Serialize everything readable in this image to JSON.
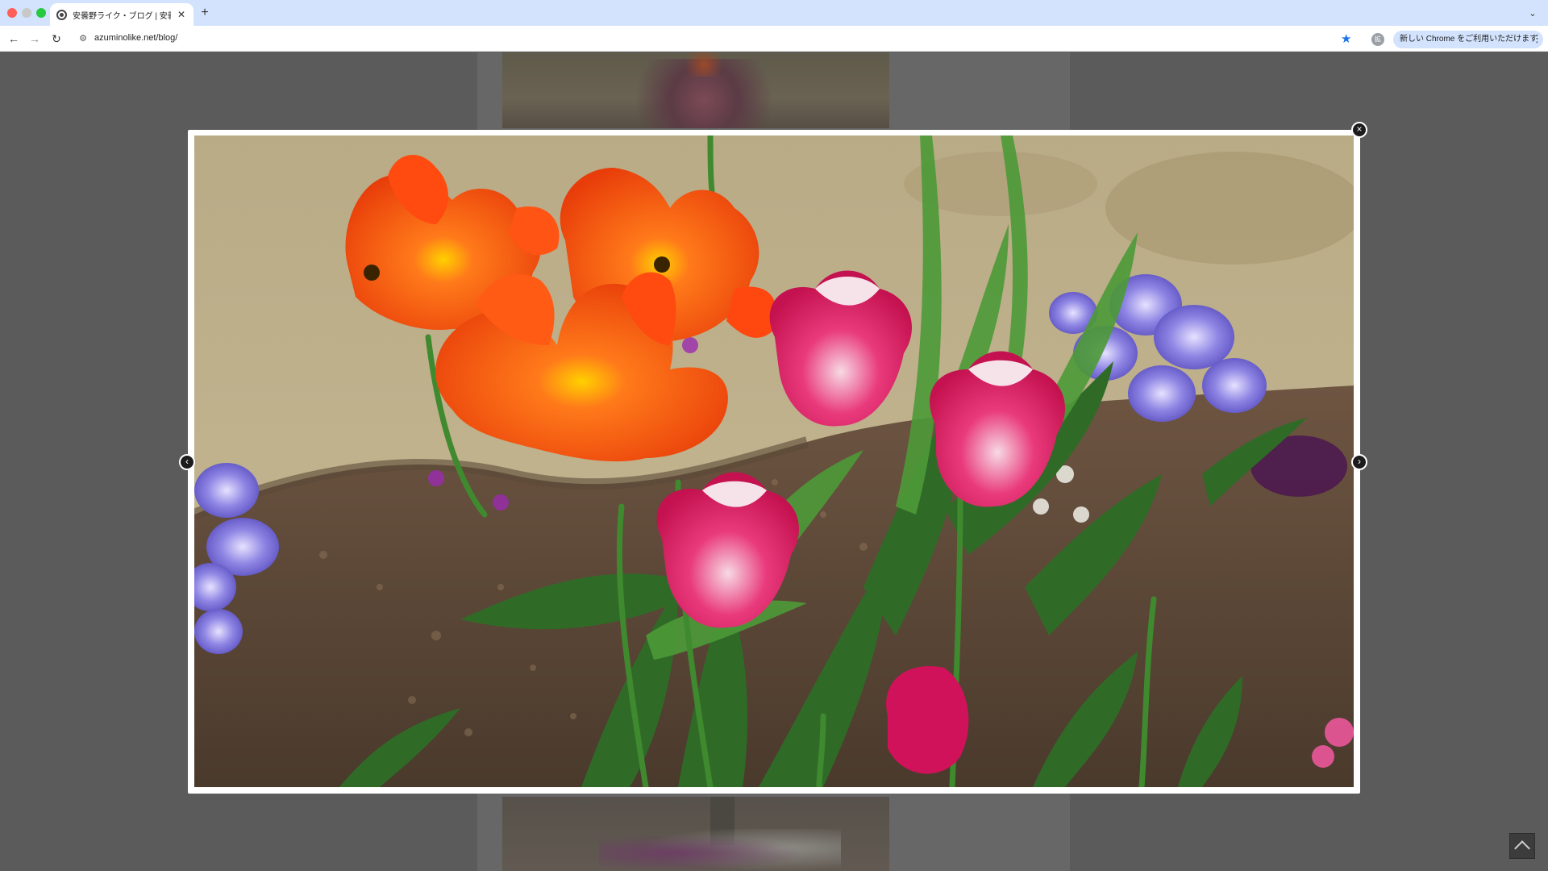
{
  "browser": {
    "tab_title": "安曇野ライク・ブログ | 安曇野ら",
    "tab_close": "✕",
    "new_tab": "+",
    "tab_menu": "⌄",
    "nav_back": "←",
    "nav_forward": "→",
    "nav_reload": "↻",
    "site_info_icon": "⚙",
    "url": "azuminolike.net/blog/",
    "bookmark_icon": "★",
    "extension_label": "拡",
    "update_label": "新しい Chrome をご利用いただけます",
    "menu_icon": "⋮"
  },
  "lightbox": {
    "close_label": "×",
    "prev_label": "‹",
    "next_label": "›"
  },
  "page": {
    "scroll_top_icon": "arrow-up-icon"
  },
  "colors": {
    "tab_strip": "#d3e3fd",
    "overlay": "#5b5b5b",
    "tulip_orange": "#ff5a14",
    "tulip_pink": "#e21f6d",
    "pansy_violet": "#8b83e4",
    "leaf_green": "#3b7a2e",
    "bookmark_blue": "#1a73e8"
  }
}
